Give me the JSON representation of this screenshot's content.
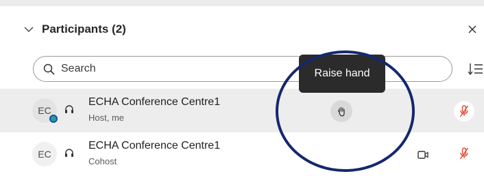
{
  "header": {
    "title": "Participants (2)",
    "collapse_icon": "chevron-down-icon",
    "close_icon": "close-icon"
  },
  "search": {
    "placeholder": "Search",
    "value": "",
    "icon": "search-icon"
  },
  "sort_icon": "sort-icon",
  "tooltip": {
    "text": "Raise hand"
  },
  "participants": [
    {
      "initials": "EC",
      "name": "ECHA Conference Centre1",
      "role": "Host, me",
      "audio_icon": "headset-icon",
      "raise_hand_icon": "hand-icon",
      "mic_icon": "mic-muted-icon"
    },
    {
      "initials": "EC",
      "name": "ECHA Conference Centre1",
      "role": "Cohost",
      "audio_icon": "headset-icon",
      "video_icon": "video-icon",
      "mic_icon": "mic-muted-icon"
    }
  ],
  "colors": {
    "highlight": "#13286e",
    "muted_mic": "#e0442e",
    "badge": "#1aa0a8"
  }
}
